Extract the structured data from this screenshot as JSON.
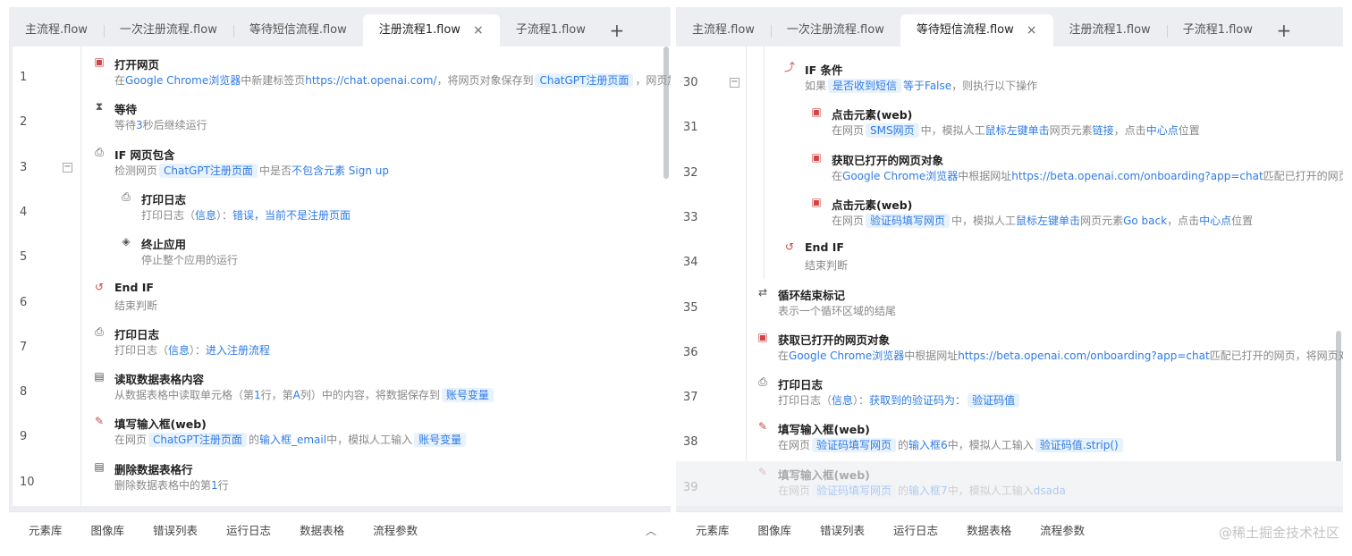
{
  "left": {
    "tabs": [
      {
        "label": "主流程.flow",
        "active": false
      },
      {
        "label": "一次注册流程.flow",
        "active": false
      },
      {
        "label": "等待短信流程.flow",
        "active": false
      },
      {
        "label": "注册流程1.flow",
        "active": true
      },
      {
        "label": "子流程1.flow",
        "active": false
      }
    ],
    "add_tab": "+",
    "close": "×",
    "steps": [
      {
        "line": "1",
        "title": "打开网页",
        "desc": [
          {
            "t": "在"
          },
          {
            "t": "Google Chrome浏览器",
            "c": "b"
          },
          {
            "t": "中新建标签页"
          },
          {
            "t": "https://chat.openai.com/",
            "c": "b"
          },
          {
            "t": "，将网页对象保存到"
          },
          {
            "t": "ChatGPT注册页面",
            "c": "tag"
          },
          {
            "t": "，网页加载..."
          }
        ]
      },
      {
        "line": "2",
        "title": "等待",
        "desc": [
          {
            "t": "等待"
          },
          {
            "t": "3",
            "c": "b"
          },
          {
            "t": "秒后继续运行"
          }
        ]
      },
      {
        "line": "3",
        "title": "IF 网页包含",
        "desc": [
          {
            "t": "检测网页"
          },
          {
            "t": "ChatGPT注册页面",
            "c": "tag"
          },
          {
            "t": "中是否"
          },
          {
            "t": "不包含元素 Sign up",
            "c": "b"
          }
        ]
      },
      {
        "line": "4",
        "title": "打印日志",
        "desc": [
          {
            "t": "打印日志（"
          },
          {
            "t": "信息",
            "c": "b"
          },
          {
            "t": "）："
          },
          {
            "t": "错误，当前不是注册页面",
            "c": "b"
          }
        ]
      },
      {
        "line": "5",
        "title": "终止应用",
        "desc": [
          {
            "t": "停止整个应用的运行"
          }
        ]
      },
      {
        "line": "6",
        "title": "End IF",
        "desc": [
          {
            "t": "结束判断"
          }
        ]
      },
      {
        "line": "7",
        "title": "打印日志",
        "desc": [
          {
            "t": "打印日志（"
          },
          {
            "t": "信息",
            "c": "b"
          },
          {
            "t": "）："
          },
          {
            "t": "进入注册流程",
            "c": "b"
          }
        ]
      },
      {
        "line": "8",
        "title": "读取数据表格内容",
        "desc": [
          {
            "t": "从数据表格中读取单元格（第"
          },
          {
            "t": "1",
            "c": "b"
          },
          {
            "t": "行，第"
          },
          {
            "t": "A",
            "c": "b"
          },
          {
            "t": "列）中的内容，将数据保存到"
          },
          {
            "t": "账号变量",
            "c": "tag"
          }
        ]
      },
      {
        "line": "9",
        "title": "填写输入框(web)",
        "desc": [
          {
            "t": "在网页"
          },
          {
            "t": "ChatGPT注册页面",
            "c": "tag"
          },
          {
            "t": "的"
          },
          {
            "t": "输入框_email",
            "c": "b"
          },
          {
            "t": "中，模拟人工输入"
          },
          {
            "t": "账号变量",
            "c": "tag"
          }
        ]
      },
      {
        "line": "10",
        "title": "删除数据表格行",
        "desc": [
          {
            "t": "删除数据表格中的第"
          },
          {
            "t": "1",
            "c": "b"
          },
          {
            "t": "行"
          }
        ]
      }
    ],
    "bottom_tabs": [
      "元素库",
      "图像库",
      "错误列表",
      "运行日志",
      "数据表格",
      "流程参数"
    ],
    "chevron": "︿"
  },
  "right": {
    "tabs": [
      {
        "label": "主流程.flow",
        "active": false
      },
      {
        "label": "一次注册流程.flow",
        "active": false
      },
      {
        "label": "等待短信流程.flow",
        "active": true
      },
      {
        "label": "注册流程1.flow",
        "active": false
      },
      {
        "label": "子流程1.flow",
        "active": false
      }
    ],
    "add_tab": "+",
    "close": "×",
    "steps": [
      {
        "line": "30",
        "title": "IF 条件",
        "desc": [
          {
            "t": "如果"
          },
          {
            "t": "是否收到短信",
            "c": "tag"
          },
          {
            "t": "等于False",
            "c": "b"
          },
          {
            "t": "，则执行以下操作"
          }
        ]
      },
      {
        "line": "31",
        "title": "点击元素(web)",
        "desc": [
          {
            "t": "在网页"
          },
          {
            "t": "SMS网页",
            "c": "tag"
          },
          {
            "t": "中，模拟人工"
          },
          {
            "t": "鼠标左键单击",
            "c": "b"
          },
          {
            "t": "网页元素"
          },
          {
            "t": "链接",
            "c": "b"
          },
          {
            "t": "，点击"
          },
          {
            "t": "中心点",
            "c": "b"
          },
          {
            "t": "位置"
          }
        ]
      },
      {
        "line": "32",
        "title": "获取已打开的网页对象",
        "desc": [
          {
            "t": "在"
          },
          {
            "t": "Google Chrome浏览器",
            "c": "b"
          },
          {
            "t": "中根据网址"
          },
          {
            "t": "https://beta.openai.com/onboarding?app=chat",
            "c": "b"
          },
          {
            "t": "匹配已打开的网页"
          }
        ]
      },
      {
        "line": "33",
        "title": "点击元素(web)",
        "desc": [
          {
            "t": "在网页"
          },
          {
            "t": "验证码填写网页",
            "c": "tag"
          },
          {
            "t": "中，模拟人工"
          },
          {
            "t": "鼠标左键单击",
            "c": "b"
          },
          {
            "t": "网页元素"
          },
          {
            "t": "Go back",
            "c": "b"
          },
          {
            "t": "，点击"
          },
          {
            "t": "中心点",
            "c": "b"
          },
          {
            "t": "位置"
          }
        ]
      },
      {
        "line": "34",
        "title": "End IF",
        "desc": [
          {
            "t": "结束判断"
          }
        ]
      },
      {
        "line": "35",
        "title": "循环结束标记",
        "desc": [
          {
            "t": "表示一个循环区域的结尾"
          }
        ]
      },
      {
        "line": "36",
        "title": "获取已打开的网页对象",
        "desc": [
          {
            "t": "在"
          },
          {
            "t": "Google Chrome浏览器",
            "c": "b"
          },
          {
            "t": "中根据网址"
          },
          {
            "t": "https://beta.openai.com/onboarding?app=chat",
            "c": "b"
          },
          {
            "t": "匹配已打开的网页，将网页对"
          }
        ]
      },
      {
        "line": "37",
        "title": "打印日志",
        "desc": [
          {
            "t": "打印日志（"
          },
          {
            "t": "信息",
            "c": "b"
          },
          {
            "t": "）："
          },
          {
            "t": "获取到的验证码为：",
            "c": "b"
          },
          {
            "t": "验证码值",
            "c": "tag"
          }
        ]
      },
      {
        "line": "38",
        "title": "填写输入框(web)",
        "desc": [
          {
            "t": "在网页"
          },
          {
            "t": "验证码填写网页",
            "c": "tag"
          },
          {
            "t": "的"
          },
          {
            "t": "输入框6",
            "c": "b"
          },
          {
            "t": "中，模拟人工输入"
          },
          {
            "t": "验证码值.strip()",
            "c": "tag"
          }
        ]
      },
      {
        "line": "39",
        "title": "填写输入框(web)",
        "disabled": true,
        "desc": [
          {
            "t": "在网页"
          },
          {
            "t": "验证码填写网页",
            "c": "tag"
          },
          {
            "t": "的"
          },
          {
            "t": "输入框7",
            "c": "b"
          },
          {
            "t": "中，模拟人工输入"
          },
          {
            "t": "dsada",
            "c": "b"
          }
        ]
      }
    ],
    "bottom_tabs": [
      "元素库",
      "图像库",
      "错误列表",
      "运行日志",
      "数据表格",
      "流程参数"
    ],
    "watermark": "@稀土掘金技术社区"
  },
  "colors": {
    "accent": "#2f7be6",
    "tag_bg": "#e8f2fd",
    "icon_red": "#d04545"
  }
}
